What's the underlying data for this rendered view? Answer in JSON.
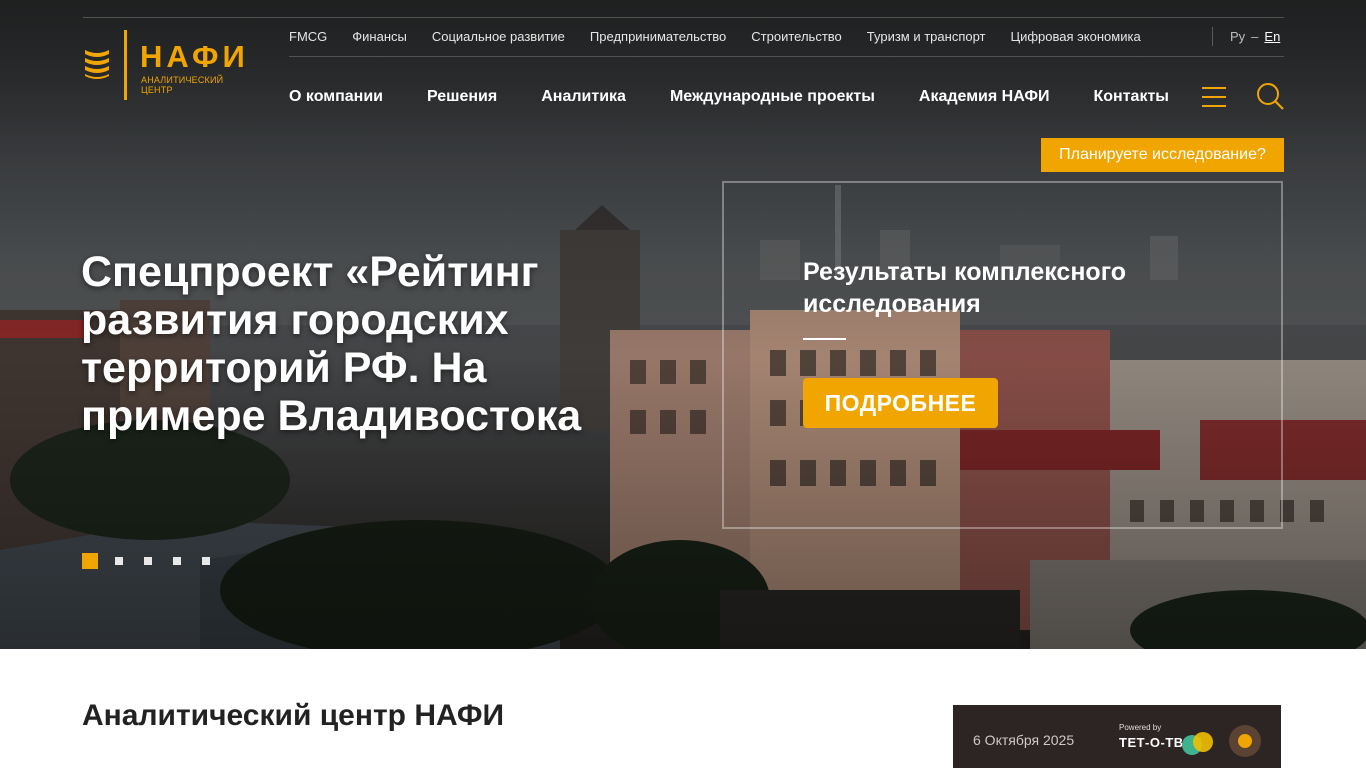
{
  "logo": {
    "name": "НАФИ",
    "subtitle": "аналитический центр"
  },
  "sectors": [
    "FMCG",
    "Финансы",
    "Социальное развитие",
    "Предпринимательство",
    "Строительство",
    "Туризм и транспорт",
    "Цифровая экономика"
  ],
  "lang": {
    "ru": "Ру",
    "dash": "–",
    "en": "En"
  },
  "mainnav": [
    "О компании",
    "Решения",
    "Аналитика",
    "Международные проекты",
    "Академия НАФИ",
    "Контакты"
  ],
  "icons": {
    "menu": "hamburger-icon",
    "search": "search-icon"
  },
  "cta_top": "Планируете исследование?",
  "hero": {
    "title": "Спецпроект «Рейтинг развития городских территорий РФ. На примере Владивостока",
    "info_title": "Результаты комплексного исследования",
    "button": "ПОДРОБНЕЕ",
    "slides_total": 5,
    "slide_active": 1
  },
  "section": {
    "title": "Аналитический центр НАФИ"
  },
  "podcast": {
    "date": "6 Октября 2025",
    "powered": "Powered by",
    "brand": "ТЕТ-О-ТВЕТ"
  },
  "colors": {
    "accent": "#f0a500",
    "dark": "#2d2424"
  }
}
